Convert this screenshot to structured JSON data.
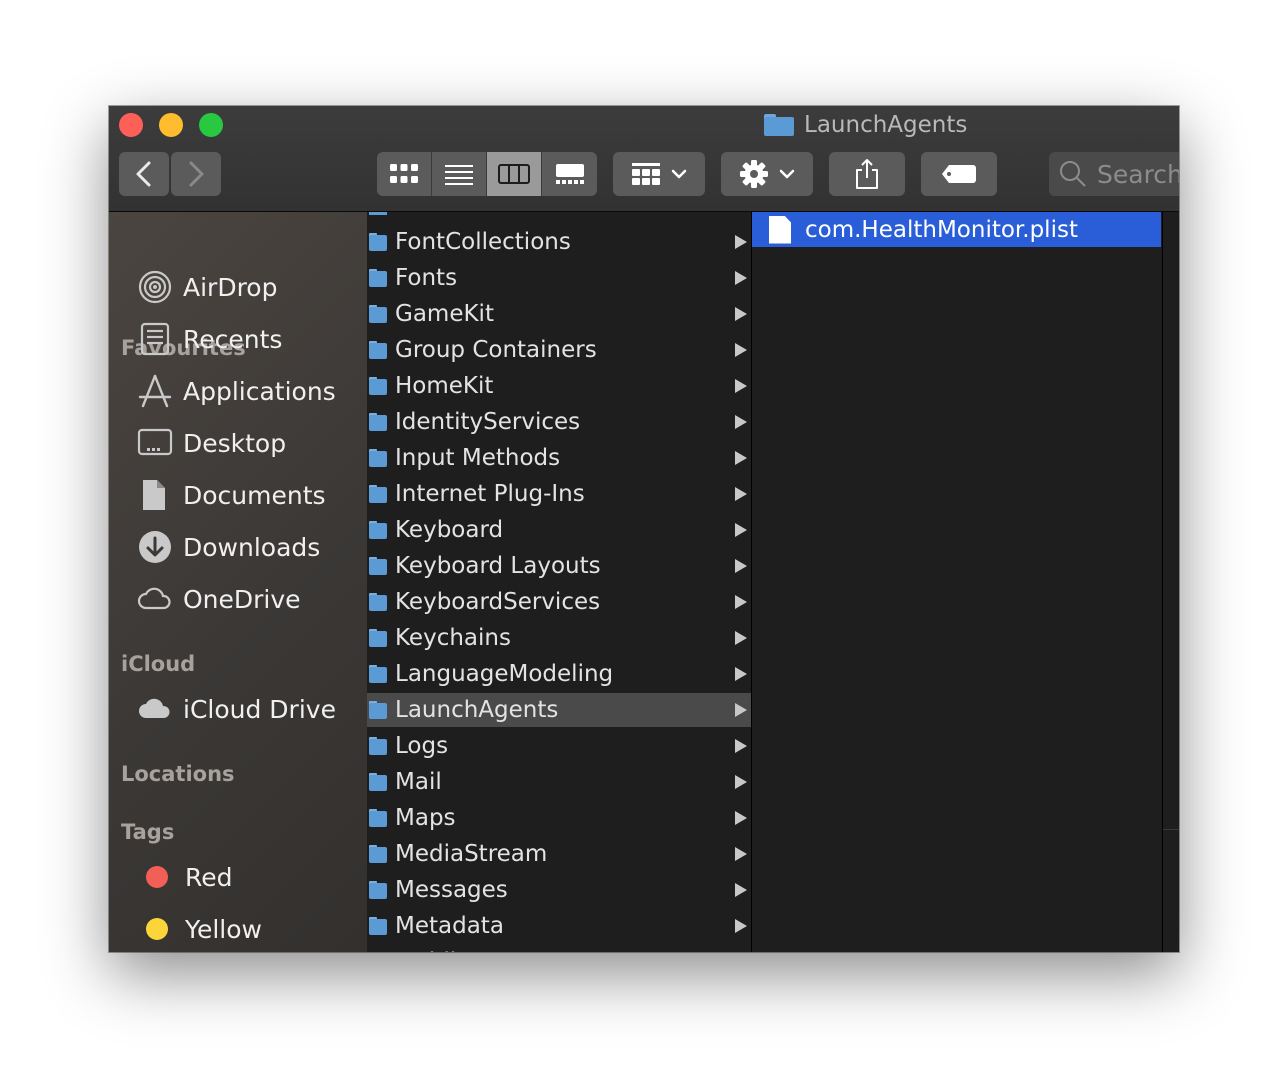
{
  "window": {
    "title": "LaunchAgents"
  },
  "toolbar": {
    "search_placeholder": "Search",
    "view_modes": [
      "icon-view",
      "list-view",
      "column-view",
      "gallery-view"
    ],
    "active_view": "column-view"
  },
  "sidebar": {
    "favourites_header": "Favourites",
    "favourites": [
      {
        "label": "AirDrop",
        "icon": "airdrop-icon"
      },
      {
        "label": "Recents",
        "icon": "recents-icon"
      },
      {
        "label": "Applications",
        "icon": "applications-icon"
      },
      {
        "label": "Desktop",
        "icon": "desktop-icon"
      },
      {
        "label": "Documents",
        "icon": "documents-icon"
      },
      {
        "label": "Downloads",
        "icon": "downloads-icon"
      },
      {
        "label": "OneDrive",
        "icon": "cloud-icon"
      }
    ],
    "icloud_header": "iCloud",
    "icloud": [
      {
        "label": "iCloud Drive",
        "icon": "icloud-icon"
      }
    ],
    "locations_header": "Locations",
    "tags_header": "Tags",
    "tags": [
      {
        "label": "Red",
        "color": "#f25f57"
      },
      {
        "label": "Yellow",
        "color": "#fbd53a"
      }
    ]
  },
  "column1": {
    "items": [
      "FontCollections",
      "Fonts",
      "GameKit",
      "Group Containers",
      "HomeKit",
      "IdentityServices",
      "Input Methods",
      "Internet Plug-Ins",
      "Keyboard",
      "Keyboard Layouts",
      "KeyboardServices",
      "Keychains",
      "LanguageModeling",
      "LaunchAgents",
      "Logs",
      "Mail",
      "Maps",
      "MediaStream",
      "Messages",
      "Metadata",
      "Mobile Documents"
    ],
    "selected": "LaunchAgents"
  },
  "column2": {
    "items": [
      "com.HealthMonitor.plist"
    ],
    "selected": "com.HealthMonitor.plist"
  }
}
